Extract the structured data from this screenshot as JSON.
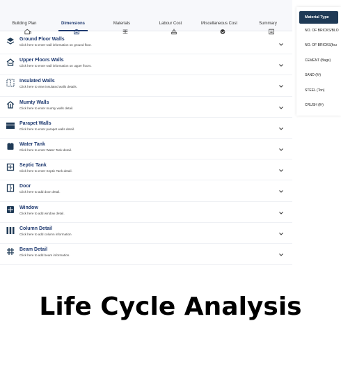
{
  "tabs": [
    {
      "label": "Building Plan",
      "icon": "building-plan-icon",
      "active": false
    },
    {
      "label": "Dimensions",
      "icon": "dimensions-icon",
      "active": true
    },
    {
      "label": "Materials",
      "icon": "materials-icon",
      "active": false
    },
    {
      "label": "Labour Cost",
      "icon": "labour-cost-icon",
      "active": false
    },
    {
      "label": "Miscellaneous Cost",
      "icon": "miscellaneous-cost-icon",
      "active": false
    },
    {
      "label": "Summary",
      "icon": "summary-icon",
      "active": false
    }
  ],
  "rows": [
    {
      "title": "Ground Floor Walls",
      "subtitle": "Click here to enter wall information on ground floor.",
      "icon": "layers-icon"
    },
    {
      "title": "Upper Floors Walls",
      "subtitle": "Click here to enter wall information on upper floors.",
      "icon": "house-icon"
    },
    {
      "title": "Insulated Walls",
      "subtitle": "Click here to view insulated walls details.",
      "icon": "insulated-wall-icon"
    },
    {
      "title": "Mumty Walls",
      "subtitle": "Click here to enter mumty walls detail.",
      "icon": "mumty-icon"
    },
    {
      "title": "Parapet Walls",
      "subtitle": "Click here to enter parapet walls detail.",
      "icon": "parapet-icon"
    },
    {
      "title": "Water Tank",
      "subtitle": "Click here to enter Water Tank detail.",
      "icon": "water-tank-icon"
    },
    {
      "title": "Septic Tank",
      "subtitle": "Click here to enter Septic Tank detail.",
      "icon": "septic-tank-icon"
    },
    {
      "title": "Door",
      "subtitle": "Click here to add door detail.",
      "icon": "door-icon"
    },
    {
      "title": "Window",
      "subtitle": "Click here to add window detail.",
      "icon": "window-icon"
    },
    {
      "title": "Column Detail",
      "subtitle": "Click here to add column information",
      "icon": "column-icon"
    },
    {
      "title": "Beam Detail",
      "subtitle": "Click here to add beam information.",
      "icon": "beam-icon"
    }
  ],
  "side_table": {
    "header": "Material Type",
    "items": [
      "NO. OF BRICKS/BLO",
      "NO. OF BRICKS(fou",
      "CEMENT (Bags)",
      "SAND (ft³)",
      "STEEL (Ton)",
      "CRUSH (ft³)"
    ]
  },
  "caption": "Life Cycle Analysis",
  "colors": {
    "accent": "#1f3a70",
    "side_header": "#1f3a56"
  }
}
